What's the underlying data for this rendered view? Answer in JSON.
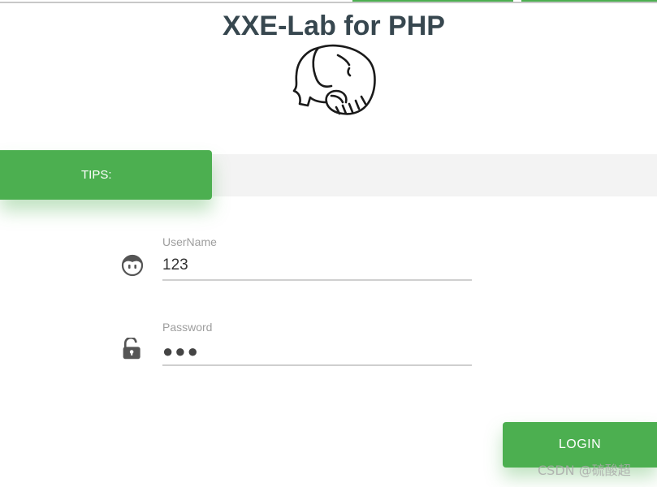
{
  "title": "XXE-Lab for PHP",
  "logo": {
    "icon": "elephant-icon"
  },
  "tips": {
    "label": "TIPS:"
  },
  "username": {
    "label": "UserName",
    "value": "123",
    "icon": "user-face-icon"
  },
  "password": {
    "label": "Password",
    "masked_value": "●●●",
    "icon": "unlock-icon"
  },
  "login": {
    "label": "LOGIN"
  },
  "watermark": {
    "text": "CSDN @硫酸超"
  },
  "colors": {
    "accent": "#4caf50",
    "title": "#37474f",
    "tips_bar": "#f3f3f3",
    "label": "#9e9e9e",
    "underline": "#cfcfcf"
  }
}
